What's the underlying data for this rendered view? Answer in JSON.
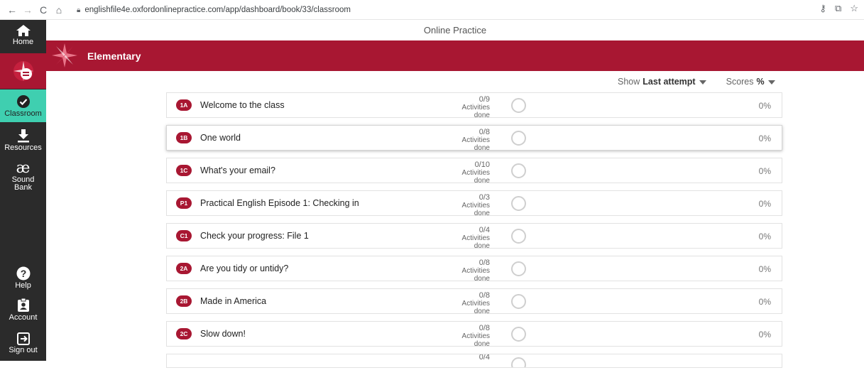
{
  "browser": {
    "url": "englishfile4e.oxfordonlinepractice.com/app/dashboard/book/33/classroom"
  },
  "header": {
    "site_title": "Online Practice",
    "book_title": "Elementary"
  },
  "sidebar": {
    "items": [
      {
        "label": "Home",
        "icon": "home-icon"
      },
      {
        "label": "Classroom",
        "icon": "check-circle-icon"
      },
      {
        "label": "Resources",
        "icon": "download-icon"
      },
      {
        "label": "Sound Bank",
        "icon": "ae-icon"
      },
      {
        "label": "Help",
        "icon": "question-icon"
      },
      {
        "label": "Account",
        "icon": "id-badge-icon"
      },
      {
        "label": "Sign out",
        "icon": "sign-out-icon"
      }
    ]
  },
  "filters": {
    "show_prefix": "Show",
    "show_value": "Last attempt",
    "scores_prefix": "Scores",
    "scores_value": "%"
  },
  "units": [
    {
      "badge": "1A",
      "title": "Welcome to the class",
      "count": "0/9",
      "activities": "Activities done",
      "score": "0%"
    },
    {
      "badge": "1B",
      "title": "One world",
      "count": "0/8",
      "activities": "Activities done",
      "score": "0%"
    },
    {
      "badge": "1C",
      "title": "What's your email?",
      "count": "0/10",
      "activities": "Activities done",
      "score": "0%"
    },
    {
      "badge": "P1",
      "title": "Practical English Episode 1: Checking in",
      "count": "0/3",
      "activities": "Activities done",
      "score": "0%"
    },
    {
      "badge": "C1",
      "title": "Check your progress: File 1",
      "count": "0/4",
      "activities": "Activities done",
      "score": "0%"
    },
    {
      "badge": "2A",
      "title": "Are you tidy or untidy?",
      "count": "0/8",
      "activities": "Activities done",
      "score": "0%"
    },
    {
      "badge": "2B",
      "title": "Made in America",
      "count": "0/8",
      "activities": "Activities done",
      "score": "0%"
    },
    {
      "badge": "2C",
      "title": "Slow down!",
      "count": "0/8",
      "activities": "Activities done",
      "score": "0%"
    },
    {
      "badge": "",
      "title": "",
      "count": "0/4",
      "activities": "",
      "score": ""
    }
  ],
  "colors": {
    "brand": "#a81732",
    "sidebar": "#2b2b2b",
    "active": "#3fcfb0"
  }
}
